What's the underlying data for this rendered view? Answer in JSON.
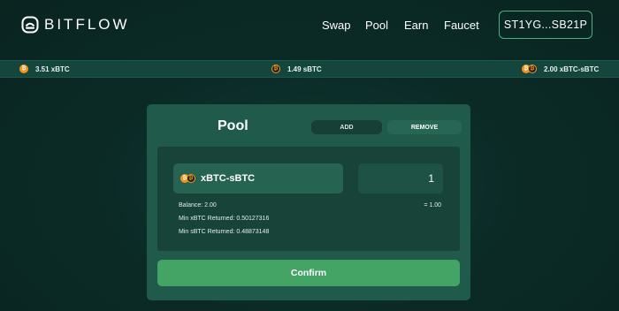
{
  "header": {
    "logo_text": "BITFLOW",
    "nav": [
      "Swap",
      "Pool",
      "Earn",
      "Faucet"
    ],
    "wallet": "ST1YG...SB21P"
  },
  "ticker": [
    {
      "amount": "3.51 xBTC",
      "icon": "xbtc-coin-icon"
    },
    {
      "amount": "1.49 sBTC",
      "icon": "sbtc-coin-icon"
    },
    {
      "amount": "2.00 xBTC-sBTC",
      "icon": "xbtc-sbtc-pair-icon"
    }
  ],
  "pool": {
    "title": "Pool",
    "tabs": {
      "add": "ADD",
      "remove": "REMOVE"
    },
    "active_tab": "REMOVE",
    "pair": "xBTC-sBTC",
    "amount": "1",
    "balance": "Balance: 2.00",
    "ratio": "= 1.00",
    "min_xbtc": "Min xBTC Returned: 0.50127316",
    "min_sbtc": "Min sBTC Returned: 0.48873148",
    "confirm": "Confirm"
  },
  "colors": {
    "background": "#0b2b27",
    "card": "#1f5a4b",
    "accent": "#44a466",
    "bitcoin_orange": "#f7931a"
  }
}
